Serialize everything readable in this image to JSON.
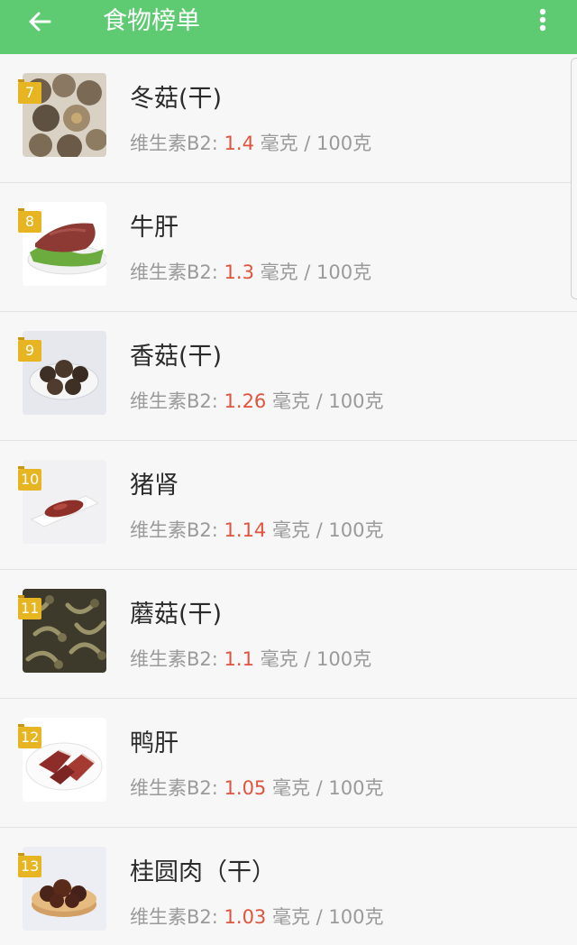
{
  "header": {
    "title": "食物榜单",
    "bg_color": "#5ecb72",
    "back_icon": "back-arrow-icon",
    "menu_icon": "more-vertical-icon"
  },
  "nutrient_label": "维生素B2: ",
  "unit": " 毫克 / 100克",
  "value_color": "#e0533c",
  "items": [
    {
      "rank": "7",
      "name": "冬菇(干)",
      "value": "1.4"
    },
    {
      "rank": "8",
      "name": "牛肝",
      "value": "1.3"
    },
    {
      "rank": "9",
      "name": "香菇(干)",
      "value": "1.26"
    },
    {
      "rank": "10",
      "name": "猪肾",
      "value": "1.14"
    },
    {
      "rank": "11",
      "name": "蘑菇(干)",
      "value": "1.1"
    },
    {
      "rank": "12",
      "name": "鸭肝",
      "value": "1.05"
    },
    {
      "rank": "13",
      "name": "桂圆肉（干）",
      "value": "1.03"
    }
  ]
}
